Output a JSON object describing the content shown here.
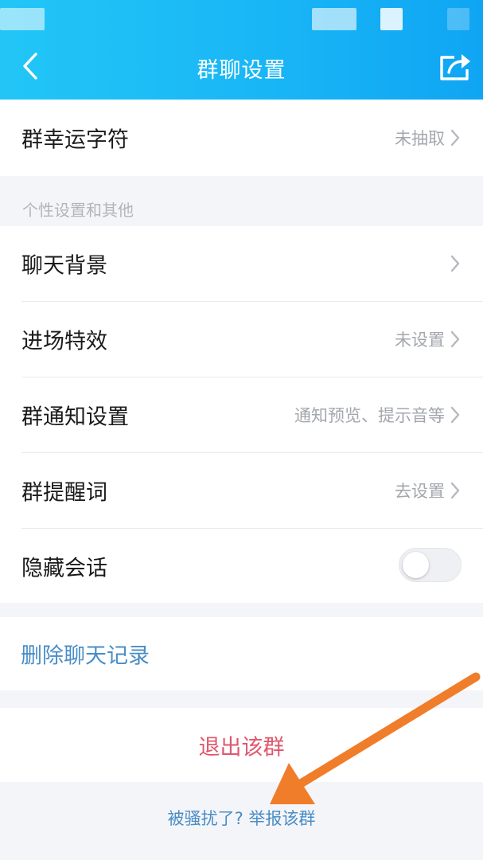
{
  "header": {
    "title": "群聊设置",
    "back_icon": "chevron-left-icon",
    "share_icon": "share-icon",
    "background": "#19b6f6"
  },
  "lucky_char": {
    "label": "群幸运字符",
    "value": "未抽取"
  },
  "section": {
    "label": "个性设置和其他"
  },
  "settings": {
    "chat_background": {
      "label": "聊天背景",
      "value": ""
    },
    "entrance_effect": {
      "label": "进场特效",
      "value": "未设置"
    },
    "notification": {
      "label": "群通知设置",
      "value": "通知预览、提示音等"
    },
    "reminder_word": {
      "label": "群提醒词",
      "value": "去设置"
    },
    "hide_chat": {
      "label": "隐藏会话",
      "enabled": false
    }
  },
  "actions": {
    "delete_history": "删除聊天记录",
    "exit_group": "退出该群",
    "report": "被骚扰了? 举报该群"
  },
  "colors": {
    "link_blue": "#4a8dc6",
    "exit_red": "#e0566d",
    "annotation_arrow": "#f07d2a"
  }
}
